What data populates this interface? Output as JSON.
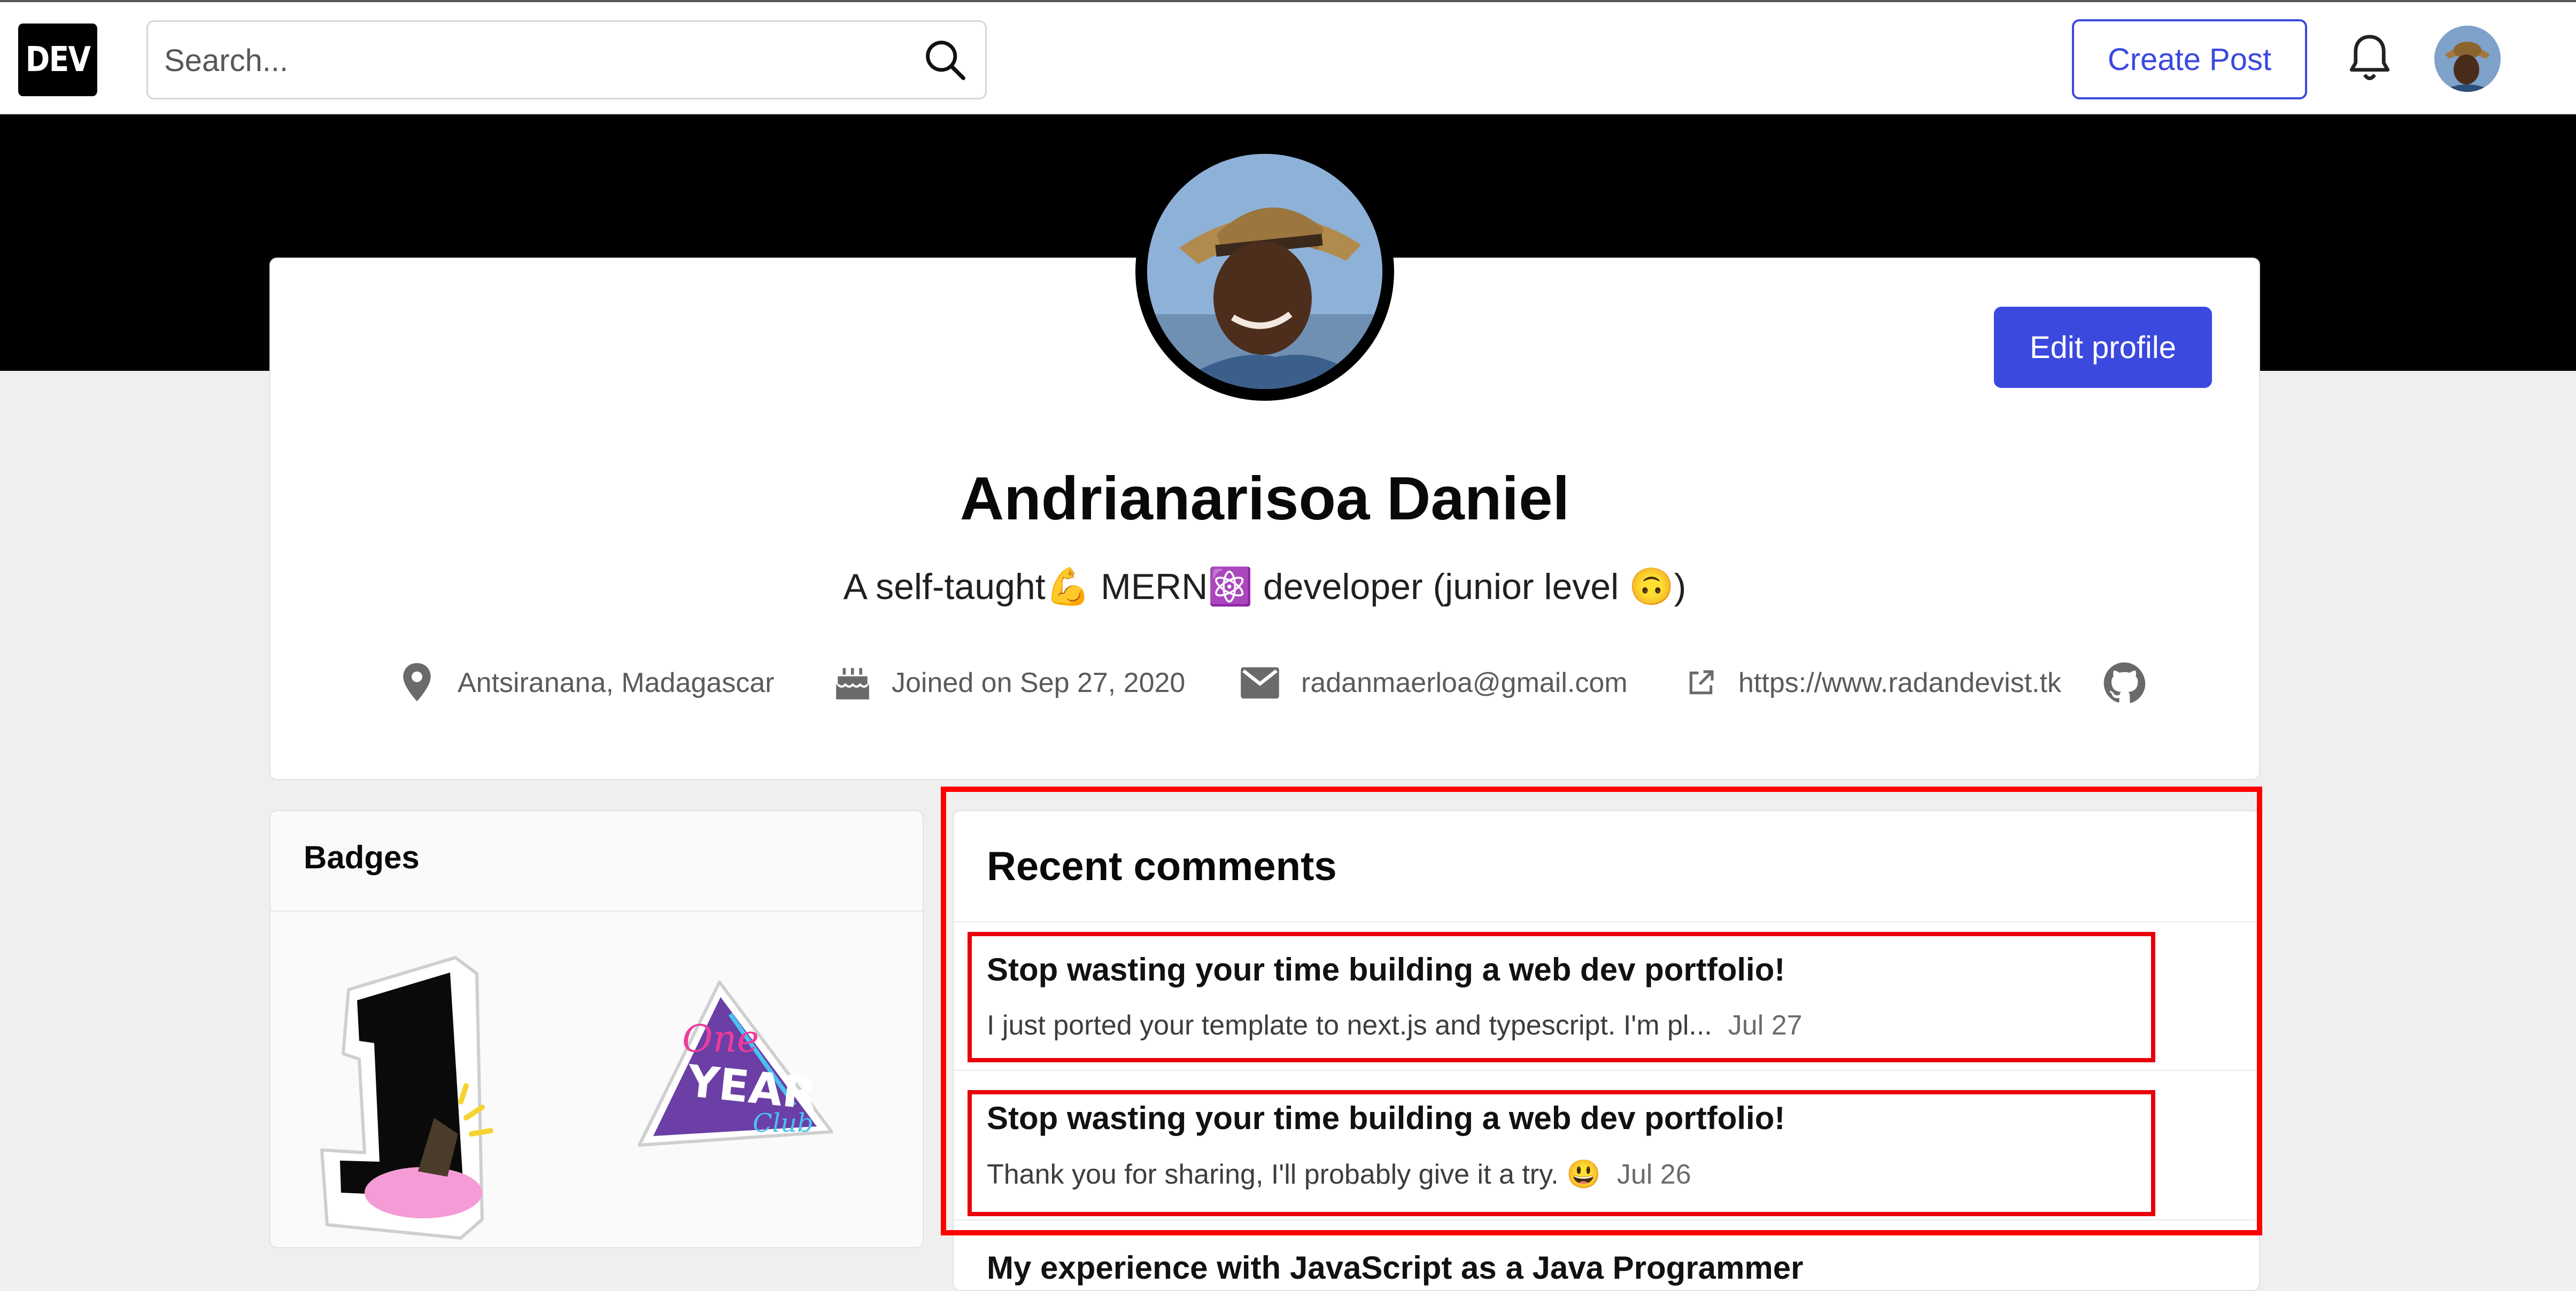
{
  "header": {
    "logo_text": "DEV",
    "search_placeholder": "Search...",
    "create_post_label": "Create Post"
  },
  "profile": {
    "name": "Andrianarisoa Daniel",
    "bio": "A self-taught💪 MERN⚛️ developer (junior level 🙃)",
    "edit_label": "Edit profile",
    "location": "Antsiranana, Madagascar",
    "joined": "Joined on Sep 27, 2020",
    "email": "radanmaerloa@gmail.com",
    "website": "https://www.radandevist.tk"
  },
  "badges": {
    "title": "Badges",
    "items": [
      "1",
      "One YEAR Club"
    ]
  },
  "comments": {
    "title": "Recent comments",
    "items": [
      {
        "title": "Stop wasting your time building a web dev portfolio!",
        "body": "I just ported your template to next.js and typescript. I'm pl...",
        "date": "Jul 27"
      },
      {
        "title": "Stop wasting your time building a web dev portfolio!",
        "body": "Thank you for sharing, I'll probably give it a try. 😃",
        "date": "Jul 26"
      },
      {
        "title": "My experience with JavaScript as a Java Programmer"
      }
    ]
  },
  "colors": {
    "accent": "#3b49df",
    "highlight": "#ff0000",
    "banner": "#000000"
  }
}
